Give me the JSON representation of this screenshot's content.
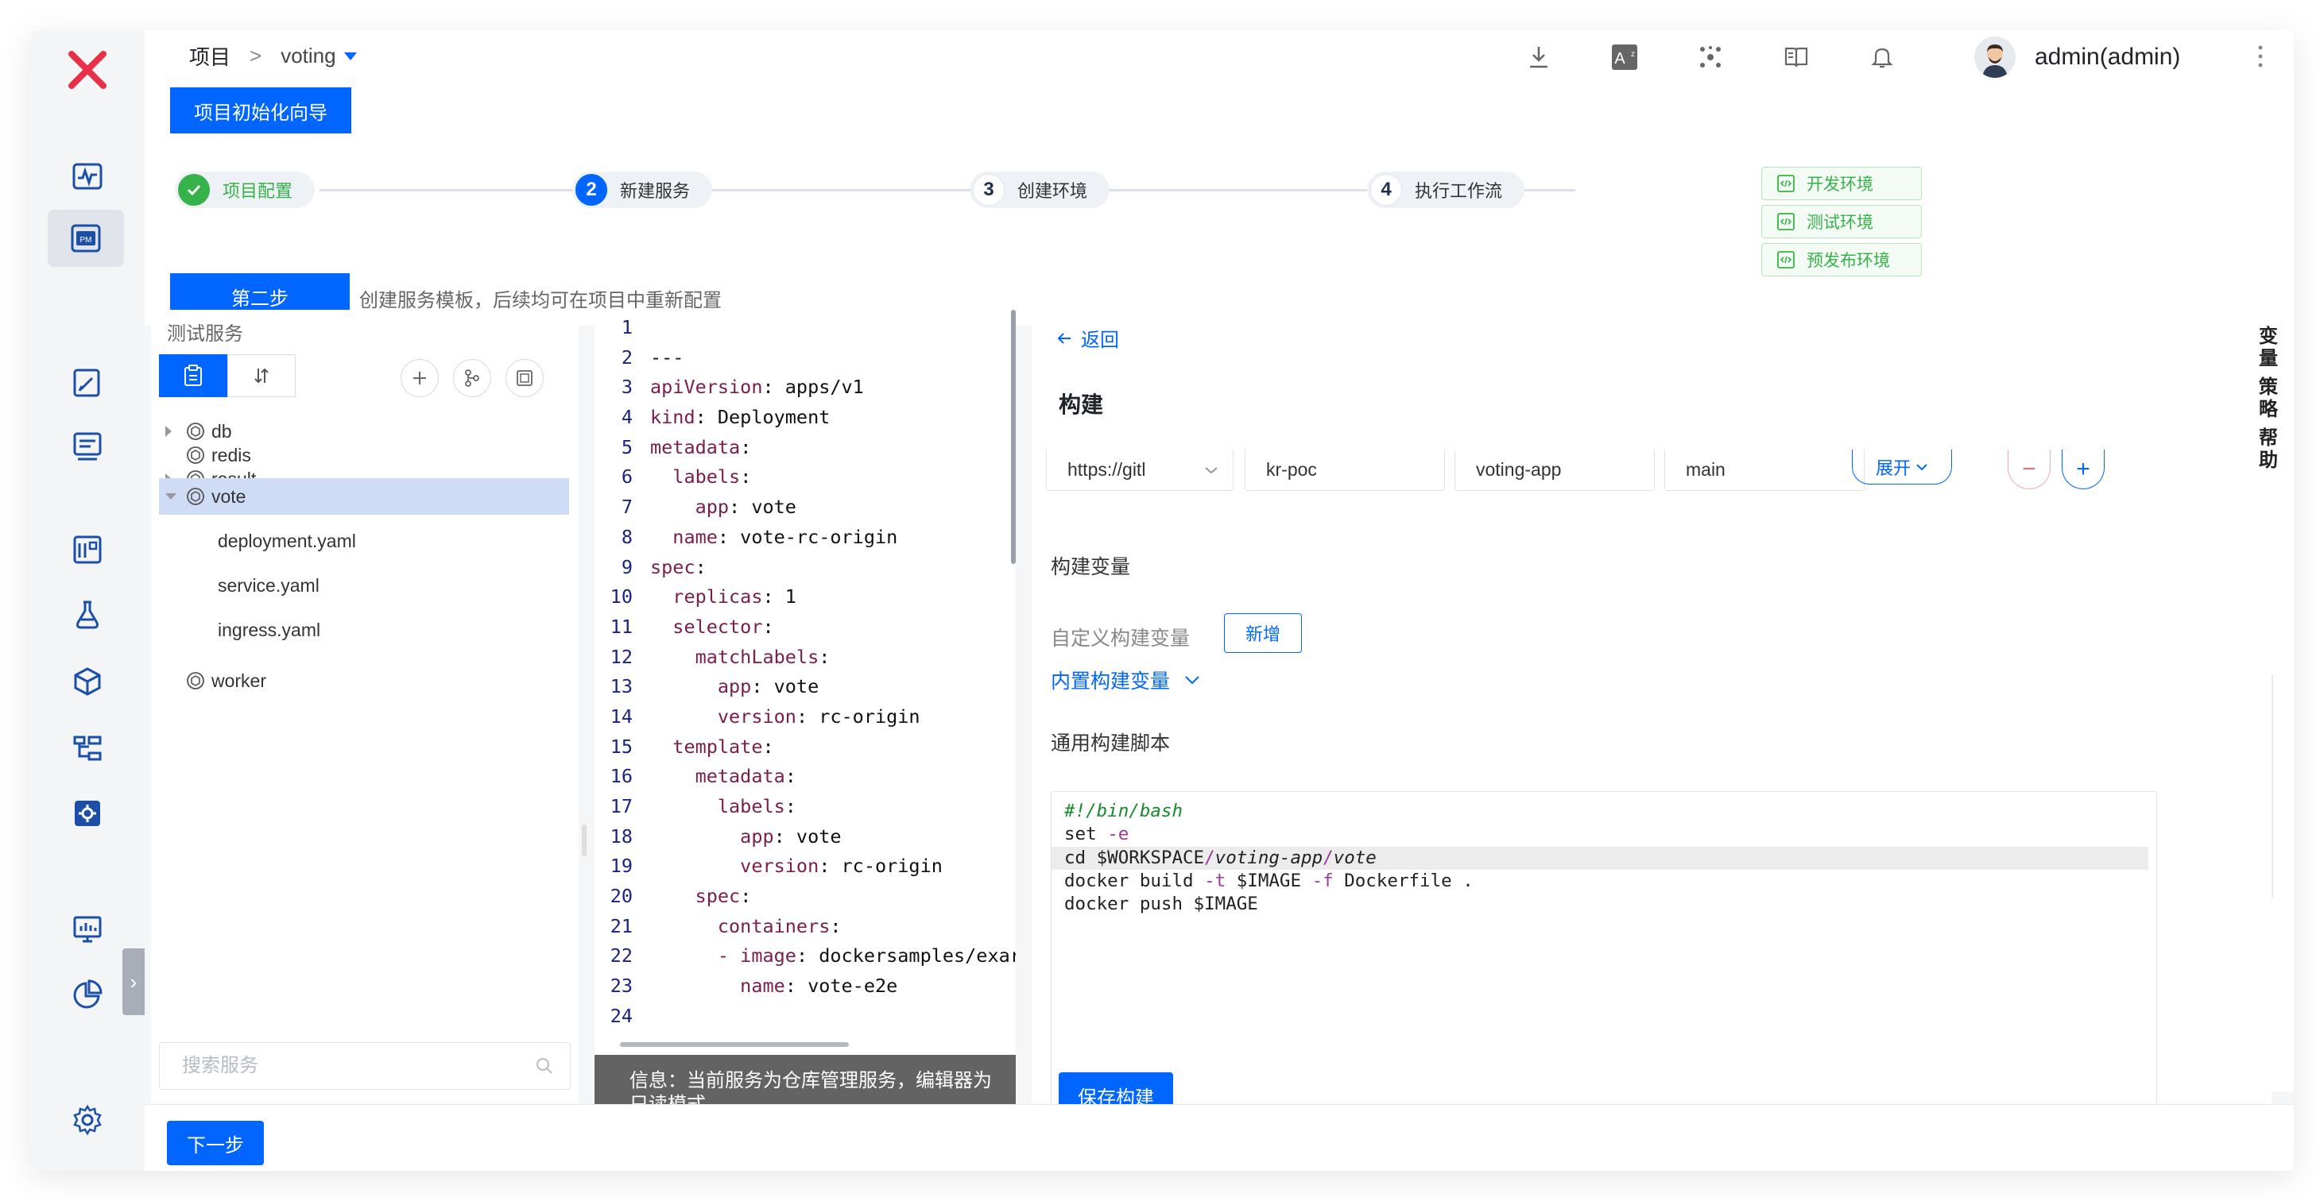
{
  "header": {
    "breadcrumb_root": "项目",
    "breadcrumb_sep": ">",
    "project_name": "voting",
    "user_name": "admin(admin)"
  },
  "wizard": {
    "guide_button": "项目初始化向导",
    "steps": [
      {
        "num": "",
        "label": "项目配置",
        "status": "done"
      },
      {
        "num": "2",
        "label": "新建服务",
        "status": "current"
      },
      {
        "num": "3",
        "label": "创建环境",
        "status": "todo"
      },
      {
        "num": "4",
        "label": "执行工作流",
        "status": "todo"
      }
    ],
    "envs": [
      "开发环境",
      "测试环境",
      "预发布环境"
    ],
    "stage_label": "第二步",
    "stage_desc": "创建服务模板，后续均可在项目中重新配置"
  },
  "services": {
    "title": "测试服务",
    "items": [
      {
        "label": "db"
      },
      {
        "label": "redis"
      },
      {
        "label": "result"
      },
      {
        "label": "vote"
      },
      {
        "label": "deployment.yaml"
      },
      {
        "label": "service.yaml"
      },
      {
        "label": "ingress.yaml"
      },
      {
        "label": "worker"
      }
    ],
    "search_placeholder": "搜索服务"
  },
  "editor": {
    "lines": [
      {
        "n": "1",
        "key": "",
        "val": ""
      },
      {
        "n": "2",
        "key": "",
        "val": "---"
      },
      {
        "n": "3",
        "key": "apiVersion",
        "val": ": apps/v1"
      },
      {
        "n": "4",
        "key": "kind",
        "val": ": Deployment"
      },
      {
        "n": "5",
        "key": "metadata",
        "val": ":"
      },
      {
        "n": "6",
        "key": "  labels",
        "val": ":"
      },
      {
        "n": "7",
        "key": "    app",
        "val": ": vote"
      },
      {
        "n": "8",
        "key": "  name",
        "val": ": vote-rc-origin"
      },
      {
        "n": "9",
        "key": "spec",
        "val": ":"
      },
      {
        "n": "10",
        "key": "  replicas",
        "val": ": 1"
      },
      {
        "n": "11",
        "key": "  selector",
        "val": ":"
      },
      {
        "n": "12",
        "key": "    matchLabels",
        "val": ":"
      },
      {
        "n": "13",
        "key": "      app",
        "val": ": vote"
      },
      {
        "n": "14",
        "key": "      version",
        "val": ": rc-origin"
      },
      {
        "n": "15",
        "key": "  template",
        "val": ":"
      },
      {
        "n": "16",
        "key": "    metadata",
        "val": ":"
      },
      {
        "n": "17",
        "key": "      labels",
        "val": ":"
      },
      {
        "n": "18",
        "key": "        app",
        "val": ": vote"
      },
      {
        "n": "19",
        "key": "        version",
        "val": ": rc-origin"
      },
      {
        "n": "20",
        "key": "    spec",
        "val": ":"
      },
      {
        "n": "21",
        "key": "      containers",
        "val": ":"
      },
      {
        "n": "22",
        "key": "      - image",
        "val": ": dockersamples/exar"
      },
      {
        "n": "23",
        "key": "        name",
        "val": ": vote-e2e"
      },
      {
        "n": "24",
        "key": "",
        "val": ""
      }
    ],
    "info": "信息：当前服务为仓库管理服务，编辑器为只读模式"
  },
  "build": {
    "back": "返回",
    "title": "构建",
    "repo": {
      "source": "https://gitl",
      "owner": "kr-poc",
      "repo": "voting-app",
      "branch": "main"
    },
    "expand": "展开",
    "vars_title": "构建变量",
    "custom_vars": "自定义构建变量",
    "add_button": "新增",
    "builtin_vars": "内置构建变量",
    "script_title": "通用构建脚本",
    "script": {
      "l1": "#!/bin/bash",
      "l2a": "set ",
      "l2b": "-e",
      "l3a": "cd $WORKSPACE",
      "l3b": "/",
      "l3c": "voting-app",
      "l3d": "/",
      "l3e": "vote",
      "l4a": "docker build ",
      "l4b": "-t",
      "l4c": " $IMAGE ",
      "l4d": "-f",
      "l4e": " Dockerfile .",
      "l5": "docker push $IMAGE"
    },
    "save_button": "保存构建"
  },
  "sidebar_right": {
    "tabs": [
      "变量",
      "策略",
      "帮助"
    ]
  },
  "footer": {
    "next_button": "下一步"
  },
  "colors": {
    "primary": "#0066ff",
    "success": "#35b34a",
    "danger": "#f56c6c",
    "logo": "#e8304b"
  }
}
